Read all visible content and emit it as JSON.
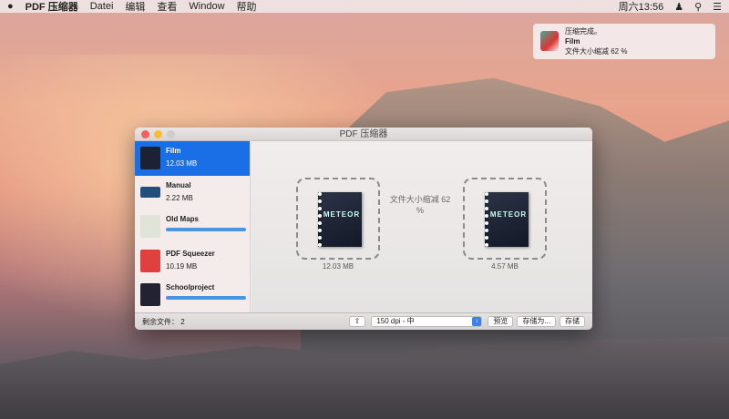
{
  "menubar": {
    "apple": "",
    "app": "PDF 压缩器",
    "items": [
      "Datei",
      "编辑",
      "查看",
      "Window",
      "帮助"
    ],
    "clock": "周六13:56",
    "user_icon": "user-icon",
    "search_icon": "search-icon",
    "list_icon": "notification-center-icon"
  },
  "notification": {
    "title": "压缩完成。",
    "file": "Film",
    "message": "文件大小缩减 62 %"
  },
  "window": {
    "title": "PDF 压缩器",
    "files": [
      {
        "name": "Film",
        "size": "12.03 MB",
        "selected": true
      },
      {
        "name": "Manual",
        "size": "2.22 MB"
      },
      {
        "name": "Old Maps",
        "progress": 1.0
      },
      {
        "name": "PDF Squeezer",
        "size": "10.19 MB"
      },
      {
        "name": "Schoolproject",
        "progress": 1.0
      }
    ],
    "original_size": "12.03 MB",
    "compressed_size": "4.57 MB",
    "reduction": "文件大小缩减 62 %",
    "doc_title": "METEOR",
    "remaining": "剩余文件： 2",
    "dpi": "150 dpi - 中",
    "preview": "预览",
    "save_as": "存储为...",
    "save": "存储"
  },
  "colors": {
    "accent": "#1a6ee6",
    "progress": "#4a94e0"
  }
}
